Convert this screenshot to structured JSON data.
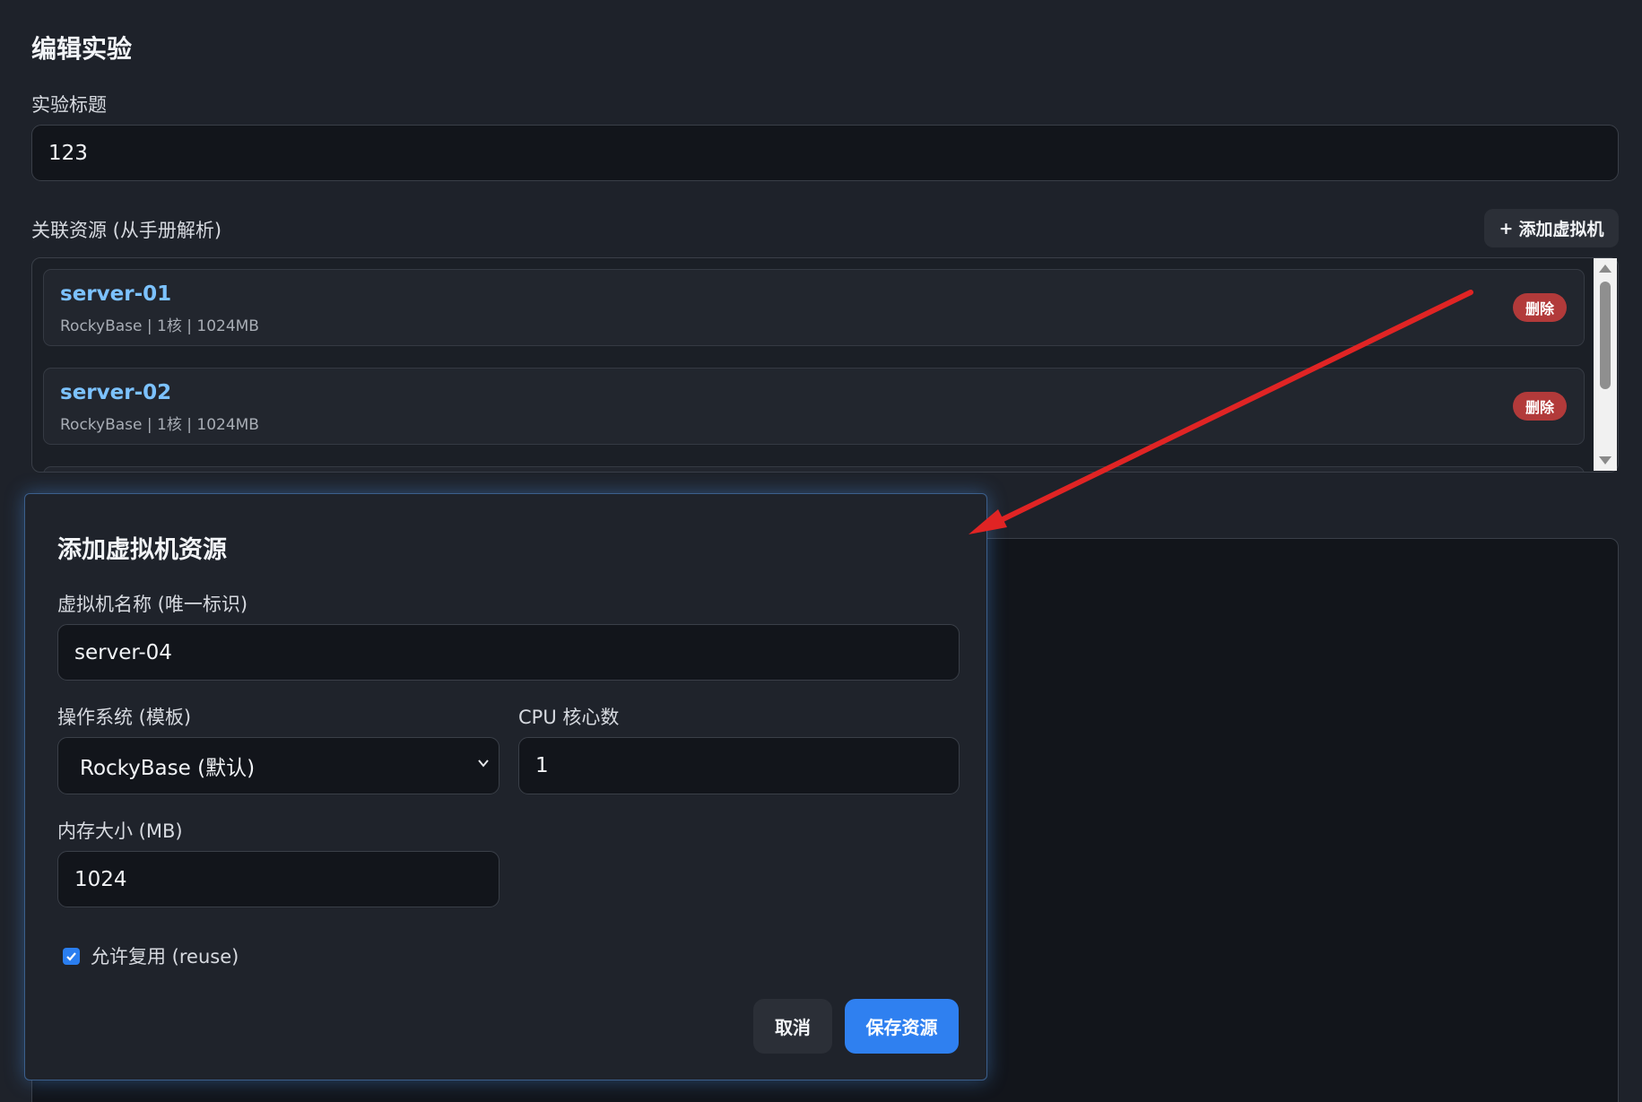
{
  "page": {
    "title": "编辑实验",
    "experiment_title_label": "实验标题",
    "experiment_title_value": "123",
    "resources_label": "关联资源 (从手册解析)",
    "add_vm_label": "添加虚拟机",
    "add_vm_icon": "plus-icon"
  },
  "resources": [
    {
      "name": "server-01",
      "meta": "RockyBase | 1核 | 1024MB",
      "delete_label": "删除"
    },
    {
      "name": "server-02",
      "meta": "RockyBase | 1核 | 1024MB",
      "delete_label": "删除"
    }
  ],
  "modal": {
    "title": "添加虚拟机资源",
    "vm_name_label": "虚拟机名称 (唯一标识)",
    "vm_name_value": "server-04",
    "os_label": "操作系统 (模板)",
    "os_selected": "RockyBase (默认)",
    "cpu_label": "CPU 核心数",
    "cpu_value": "1",
    "memory_label": "内存大小 (MB)",
    "memory_value": "1024",
    "reuse_label": "允许复用 (reuse)",
    "reuse_checked": true,
    "cancel_label": "取消",
    "save_label": "保存资源"
  },
  "colors": {
    "background": "#1e222a",
    "accent": "#2f80f0",
    "resource_name": "#7cc2ff",
    "danger": "#b23a3a",
    "annotation_arrow": "#e02424"
  }
}
